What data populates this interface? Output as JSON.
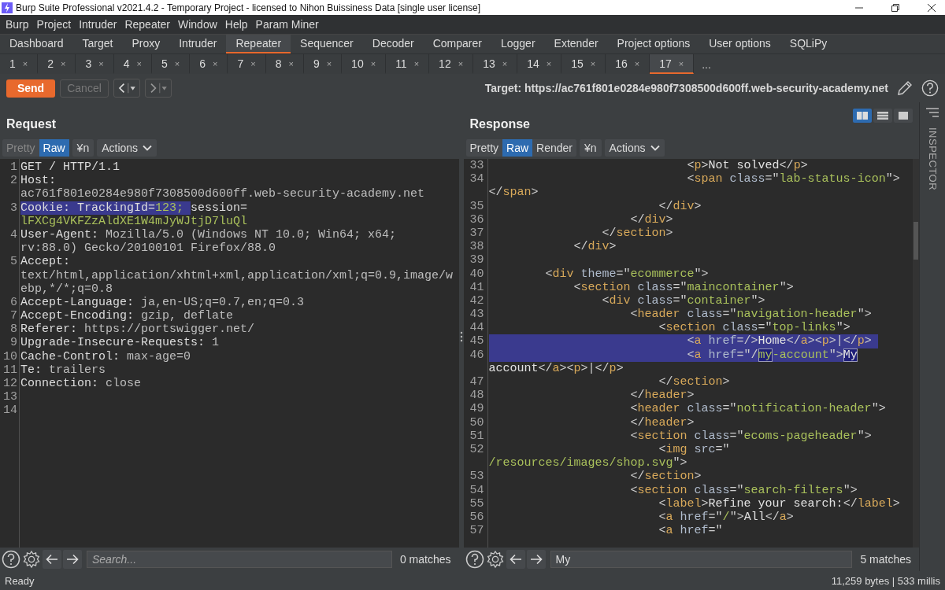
{
  "window": {
    "title": "Burp Suite Professional v2021.4.2 - Temporary Project - licensed to Nihon Buissiness Data [single user license]"
  },
  "menu": [
    "Burp",
    "Project",
    "Intruder",
    "Repeater",
    "Window",
    "Help",
    "Param Miner"
  ],
  "main_tabs": [
    {
      "label": "Dashboard",
      "selected": false
    },
    {
      "label": "Target",
      "selected": false
    },
    {
      "label": "Proxy",
      "selected": false
    },
    {
      "label": "Intruder",
      "selected": false
    },
    {
      "label": "Repeater",
      "selected": true
    },
    {
      "label": "Sequencer",
      "selected": false
    },
    {
      "label": "Decoder",
      "selected": false
    },
    {
      "label": "Comparer",
      "selected": false
    },
    {
      "label": "Logger",
      "selected": false
    },
    {
      "label": "Extender",
      "selected": false
    },
    {
      "label": "Project options",
      "selected": false
    },
    {
      "label": "User options",
      "selected": false
    },
    {
      "label": "SQLiPy",
      "selected": false
    }
  ],
  "repeater_tabs": [
    {
      "label": "1",
      "close": "×",
      "selected": false
    },
    {
      "label": "2",
      "close": "×",
      "selected": false
    },
    {
      "label": "3",
      "close": "×",
      "selected": false
    },
    {
      "label": "4",
      "close": "×",
      "selected": false
    },
    {
      "label": "5",
      "close": "×",
      "selected": false
    },
    {
      "label": "6",
      "close": "×",
      "selected": false
    },
    {
      "label": "7",
      "close": "×",
      "selected": false
    },
    {
      "label": "8",
      "close": "×",
      "selected": false
    },
    {
      "label": "9",
      "close": "×",
      "selected": false
    },
    {
      "label": "10",
      "close": "×",
      "selected": false
    },
    {
      "label": "11",
      "close": "×",
      "selected": false
    },
    {
      "label": "12",
      "close": "×",
      "selected": false
    },
    {
      "label": "13",
      "close": "×",
      "selected": false
    },
    {
      "label": "14",
      "close": "×",
      "selected": false
    },
    {
      "label": "15",
      "close": "×",
      "selected": false
    },
    {
      "label": "16",
      "close": "×",
      "selected": false
    },
    {
      "label": "17",
      "close": "×",
      "selected": true
    }
  ],
  "more_tabs": "...",
  "toolbar": {
    "send": "Send",
    "cancel": {
      "label": "Cancel",
      "disabled": true
    },
    "target": "Target: https://ac761f801e0284e980f7308500d600ff.web-security-academy.net"
  },
  "layout_buttons": [
    {
      "kind": "columns",
      "selected": true
    },
    {
      "kind": "rows",
      "selected": false
    },
    {
      "kind": "single",
      "selected": false
    }
  ],
  "inspector": "INSPECTOR",
  "request": {
    "title": "Request",
    "view_buttons": [
      {
        "label": "Pretty",
        "selected": false,
        "disabled": true
      },
      {
        "label": "Raw",
        "selected": true,
        "disabled": false
      }
    ],
    "newline_button": "¥n",
    "actions": "Actions",
    "lines": [
      {
        "number": "1",
        "highlighted": false,
        "segments": [
          {
            "kind": "name",
            "text": "GET / HTTP/1.1"
          }
        ]
      },
      {
        "number": "2",
        "highlighted": false,
        "segments": [
          {
            "kind": "name",
            "text": "Host:"
          }
        ]
      },
      {
        "highlighted": false,
        "segments": [
          {
            "kind": "value",
            "text": "ac761f801e0284e980f7308500d600ff.web-security-academy.net"
          }
        ]
      },
      {
        "number": "3",
        "highlighted": false,
        "segments": [
          {
            "kind": "name",
            "text": "Cookie: TrackingId=",
            "selected": true
          },
          {
            "kind": "cookie",
            "text": "123; ",
            "selected": true
          },
          {
            "kind": "name",
            "text": "session=",
            "selected": false
          }
        ]
      },
      {
        "highlighted": false,
        "segments": [
          {
            "kind": "cookie",
            "text": "lFXCg4VKFZzAldXE1W4mJyWJtjD7luQl"
          }
        ]
      },
      {
        "number": "4",
        "highlighted": false,
        "segments": [
          {
            "kind": "name",
            "text": "User-Agent:"
          },
          {
            "kind": "value",
            "text": " Mozilla/5.0 (Windows NT 10.0; Win64; x64;"
          }
        ]
      },
      {
        "highlighted": false,
        "segments": [
          {
            "kind": "value",
            "text": "rv:88.0) Gecko/20100101 Firefox/88.0"
          }
        ]
      },
      {
        "number": "5",
        "highlighted": false,
        "segments": [
          {
            "kind": "name",
            "text": "Accept:"
          }
        ]
      },
      {
        "highlighted": false,
        "segments": [
          {
            "kind": "value",
            "text": "text/html,application/xhtml+xml,application/xml;q=0.9,image/w"
          }
        ]
      },
      {
        "highlighted": false,
        "segments": [
          {
            "kind": "value",
            "text": "ebp,*/*;q=0.8"
          }
        ]
      },
      {
        "number": "6",
        "highlighted": false,
        "segments": [
          {
            "kind": "name",
            "text": "Accept-Language:"
          },
          {
            "kind": "value",
            "text": " ja,en-US;q=0.7,en;q=0.3"
          }
        ]
      },
      {
        "number": "7",
        "highlighted": false,
        "segments": [
          {
            "kind": "name",
            "text": "Accept-Encoding:"
          },
          {
            "kind": "value",
            "text": " gzip, deflate"
          }
        ]
      },
      {
        "number": "8",
        "highlighted": false,
        "segments": [
          {
            "kind": "name",
            "text": "Referer:"
          },
          {
            "kind": "value",
            "text": " https://portswigger.net/"
          }
        ]
      },
      {
        "number": "9",
        "highlighted": false,
        "segments": [
          {
            "kind": "name",
            "text": "Upgrade-Insecure-Requests:"
          },
          {
            "kind": "value",
            "text": " 1"
          }
        ]
      },
      {
        "number": "10",
        "highlighted": false,
        "segments": [
          {
            "kind": "name",
            "text": "Cache-Control:"
          },
          {
            "kind": "value",
            "text": " max-age=0"
          }
        ]
      },
      {
        "number": "11",
        "highlighted": false,
        "segments": [
          {
            "kind": "name",
            "text": "Te:"
          },
          {
            "kind": "value",
            "text": " trailers"
          }
        ]
      },
      {
        "number": "12",
        "highlighted": false,
        "segments": [
          {
            "kind": "name",
            "text": "Connection:"
          },
          {
            "kind": "value",
            "text": " close"
          }
        ]
      },
      {
        "number": "13",
        "highlighted": false
      },
      {
        "number": "14",
        "highlighted": false
      }
    ],
    "search": {
      "placeholder": "Search...",
      "matches": "0 matches"
    }
  },
  "response": {
    "title": "Response",
    "view_buttons": [
      {
        "label": "Pretty",
        "selected": false,
        "disabled": false
      },
      {
        "label": "Raw",
        "selected": true,
        "disabled": false
      },
      {
        "label": "Render",
        "selected": false,
        "disabled": false
      }
    ],
    "newline_button": "¥n",
    "actions": "Actions",
    "lines": [
      {
        "number": "33",
        "highlighted": false,
        "segments": [
          {
            "kind": "punct",
            "text": "                            <"
          },
          {
            "kind": "tag",
            "text": "p"
          },
          {
            "kind": "punct",
            "text": ">"
          },
          {
            "kind": "text",
            "text": "Not solved"
          },
          {
            "kind": "punct",
            "text": "</"
          },
          {
            "kind": "tag",
            "text": "p"
          },
          {
            "kind": "punct",
            "text": ">"
          }
        ]
      },
      {
        "number": "34",
        "highlighted": false,
        "segments": [
          {
            "kind": "punct",
            "text": "                            <"
          },
          {
            "kind": "tag",
            "text": "span"
          },
          {
            "kind": "attr",
            "text": " class"
          },
          {
            "kind": "punct",
            "text": "=\""
          },
          {
            "kind": "str",
            "text": "lab-status-icon"
          },
          {
            "kind": "punct",
            "text": "\">"
          }
        ]
      },
      {
        "highlighted": false,
        "segments": [
          {
            "kind": "punct",
            "text": "</"
          },
          {
            "kind": "tag",
            "text": "span"
          },
          {
            "kind": "punct",
            "text": ">"
          }
        ]
      },
      {
        "number": "35",
        "highlighted": false,
        "segments": [
          {
            "kind": "punct",
            "text": "                        </"
          },
          {
            "kind": "tag",
            "text": "div"
          },
          {
            "kind": "punct",
            "text": ">"
          }
        ]
      },
      {
        "number": "36",
        "highlighted": false,
        "segments": [
          {
            "kind": "punct",
            "text": "                    </"
          },
          {
            "kind": "tag",
            "text": "div"
          },
          {
            "kind": "punct",
            "text": ">"
          }
        ]
      },
      {
        "number": "37",
        "highlighted": false,
        "segments": [
          {
            "kind": "punct",
            "text": "                </"
          },
          {
            "kind": "tag",
            "text": "section"
          },
          {
            "kind": "punct",
            "text": ">"
          }
        ]
      },
      {
        "number": "38",
        "highlighted": false,
        "segments": [
          {
            "kind": "punct",
            "text": "            </"
          },
          {
            "kind": "tag",
            "text": "div"
          },
          {
            "kind": "punct",
            "text": ">"
          }
        ]
      },
      {
        "number": "39",
        "highlighted": false
      },
      {
        "number": "40",
        "highlighted": false,
        "segments": [
          {
            "kind": "punct",
            "text": "        <"
          },
          {
            "kind": "tag",
            "text": "div"
          },
          {
            "kind": "attr",
            "text": " theme"
          },
          {
            "kind": "punct",
            "text": "=\""
          },
          {
            "kind": "str",
            "text": "ecommerce"
          },
          {
            "kind": "punct",
            "text": "\">"
          }
        ]
      },
      {
        "number": "41",
        "highlighted": false,
        "segments": [
          {
            "kind": "punct",
            "text": "            <"
          },
          {
            "kind": "tag",
            "text": "section"
          },
          {
            "kind": "attr",
            "text": " class"
          },
          {
            "kind": "punct",
            "text": "=\""
          },
          {
            "kind": "str",
            "text": "maincontainer"
          },
          {
            "kind": "punct",
            "text": "\">"
          }
        ]
      },
      {
        "number": "42",
        "highlighted": false,
        "segments": [
          {
            "kind": "punct",
            "text": "                <"
          },
          {
            "kind": "tag",
            "text": "div"
          },
          {
            "kind": "attr",
            "text": " class"
          },
          {
            "kind": "punct",
            "text": "=\""
          },
          {
            "kind": "str",
            "text": "container"
          },
          {
            "kind": "punct",
            "text": "\">"
          }
        ]
      },
      {
        "number": "43",
        "highlighted": false,
        "segments": [
          {
            "kind": "punct",
            "text": "                    <"
          },
          {
            "kind": "tag",
            "text": "header"
          },
          {
            "kind": "attr",
            "text": " class"
          },
          {
            "kind": "punct",
            "text": "=\""
          },
          {
            "kind": "str",
            "text": "navigation-header"
          },
          {
            "kind": "punct",
            "text": "\">"
          }
        ]
      },
      {
        "number": "44",
        "highlighted": false,
        "segments": [
          {
            "kind": "punct",
            "text": "                        <"
          },
          {
            "kind": "tag",
            "text": "section"
          },
          {
            "kind": "attr",
            "text": " class"
          },
          {
            "kind": "punct",
            "text": "=\""
          },
          {
            "kind": "str",
            "text": "top-links"
          },
          {
            "kind": "punct",
            "text": "\">"
          }
        ]
      },
      {
        "number": "45",
        "highlighted": true,
        "segments": [
          {
            "kind": "punct",
            "text": "                            <"
          },
          {
            "kind": "tag",
            "text": "a"
          },
          {
            "kind": "attr",
            "text": " href"
          },
          {
            "kind": "punct",
            "text": "=/>"
          },
          {
            "kind": "text",
            "text": "Home"
          },
          {
            "kind": "punct",
            "text": "</"
          },
          {
            "kind": "tag",
            "text": "a"
          },
          {
            "kind": "punct",
            "text": "><"
          },
          {
            "kind": "tag",
            "text": "p"
          },
          {
            "kind": "punct",
            "text": ">|</"
          },
          {
            "kind": "tag",
            "text": "p"
          },
          {
            "kind": "punct",
            "text": ">"
          }
        ]
      },
      {
        "number": "46",
        "highlighted": true,
        "segments": [
          {
            "kind": "punct",
            "text": "                            <",
            "match": false
          },
          {
            "kind": "tag",
            "text": "a",
            "match": false
          },
          {
            "kind": "attr",
            "text": " href",
            "match": false
          },
          {
            "kind": "punct",
            "text": "=\"/",
            "match": false
          },
          {
            "kind": "str",
            "text": "my",
            "match": true
          },
          {
            "kind": "str",
            "text": "-account",
            "match": false
          },
          {
            "kind": "punct",
            "text": "\">",
            "match": false
          },
          {
            "kind": "text",
            "text": "My",
            "match": true
          }
        ]
      },
      {
        "highlighted": false,
        "segments": [
          {
            "kind": "text",
            "text": "account"
          },
          {
            "kind": "punct",
            "text": "</"
          },
          {
            "kind": "tag",
            "text": "a"
          },
          {
            "kind": "punct",
            "text": "><"
          },
          {
            "kind": "tag",
            "text": "p"
          },
          {
            "kind": "punct",
            "text": ">|</"
          },
          {
            "kind": "tag",
            "text": "p"
          },
          {
            "kind": "punct",
            "text": ">"
          }
        ]
      },
      {
        "number": "47",
        "highlighted": false,
        "segments": [
          {
            "kind": "punct",
            "text": "                        </"
          },
          {
            "kind": "tag",
            "text": "section"
          },
          {
            "kind": "punct",
            "text": ">"
          }
        ]
      },
      {
        "number": "48",
        "highlighted": false,
        "segments": [
          {
            "kind": "punct",
            "text": "                    </"
          },
          {
            "kind": "tag",
            "text": "header"
          },
          {
            "kind": "punct",
            "text": ">"
          }
        ]
      },
      {
        "number": "49",
        "highlighted": false,
        "segments": [
          {
            "kind": "punct",
            "text": "                    <"
          },
          {
            "kind": "tag",
            "text": "header"
          },
          {
            "kind": "attr",
            "text": " class"
          },
          {
            "kind": "punct",
            "text": "=\""
          },
          {
            "kind": "str",
            "text": "notification-header"
          },
          {
            "kind": "punct",
            "text": "\">"
          }
        ]
      },
      {
        "number": "50",
        "highlighted": false,
        "segments": [
          {
            "kind": "punct",
            "text": "                    </"
          },
          {
            "kind": "tag",
            "text": "header"
          },
          {
            "kind": "punct",
            "text": ">"
          }
        ]
      },
      {
        "number": "51",
        "highlighted": false,
        "segments": [
          {
            "kind": "punct",
            "text": "                    <"
          },
          {
            "kind": "tag",
            "text": "section"
          },
          {
            "kind": "attr",
            "text": " class"
          },
          {
            "kind": "punct",
            "text": "=\""
          },
          {
            "kind": "str",
            "text": "ecoms-pageheader"
          },
          {
            "kind": "punct",
            "text": "\">"
          }
        ]
      },
      {
        "number": "52",
        "highlighted": false,
        "segments": [
          {
            "kind": "punct",
            "text": "                        <"
          },
          {
            "kind": "tag",
            "text": "img"
          },
          {
            "kind": "attr",
            "text": " src"
          },
          {
            "kind": "punct",
            "text": "=\""
          }
        ]
      },
      {
        "highlighted": false,
        "segments": [
          {
            "kind": "str",
            "text": "/resources/images/shop.svg"
          },
          {
            "kind": "punct",
            "text": "\">"
          }
        ]
      },
      {
        "number": "53",
        "highlighted": false,
        "segments": [
          {
            "kind": "punct",
            "text": "                    </"
          },
          {
            "kind": "tag",
            "text": "section"
          },
          {
            "kind": "punct",
            "text": ">"
          }
        ]
      },
      {
        "number": "54",
        "highlighted": false,
        "segments": [
          {
            "kind": "punct",
            "text": "                    <"
          },
          {
            "kind": "tag",
            "text": "section"
          },
          {
            "kind": "attr",
            "text": " class"
          },
          {
            "kind": "punct",
            "text": "=\""
          },
          {
            "kind": "str",
            "text": "search-filters"
          },
          {
            "kind": "punct",
            "text": "\">"
          }
        ]
      },
      {
        "number": "55",
        "highlighted": false,
        "segments": [
          {
            "kind": "punct",
            "text": "                        <"
          },
          {
            "kind": "tag",
            "text": "label"
          },
          {
            "kind": "punct",
            "text": ">"
          },
          {
            "kind": "text",
            "text": "Refine your search:"
          },
          {
            "kind": "punct",
            "text": "</"
          },
          {
            "kind": "tag",
            "text": "label"
          },
          {
            "kind": "punct",
            "text": ">"
          }
        ]
      },
      {
        "number": "56",
        "highlighted": false,
        "segments": [
          {
            "kind": "punct",
            "text": "                        <"
          },
          {
            "kind": "tag",
            "text": "a"
          },
          {
            "kind": "attr",
            "text": " href"
          },
          {
            "kind": "punct",
            "text": "=\""
          },
          {
            "kind": "str",
            "text": "/"
          },
          {
            "kind": "punct",
            "text": "\">"
          },
          {
            "kind": "text",
            "text": "All"
          },
          {
            "kind": "punct",
            "text": "</"
          },
          {
            "kind": "tag",
            "text": "a"
          },
          {
            "kind": "punct",
            "text": ">"
          }
        ]
      },
      {
        "number": "57",
        "highlighted": false,
        "segments": [
          {
            "kind": "punct",
            "text": "                        <"
          },
          {
            "kind": "tag",
            "text": "a"
          },
          {
            "kind": "attr",
            "text": " href"
          },
          {
            "kind": "punct",
            "text": "=\""
          }
        ]
      }
    ],
    "search": {
      "value": "My",
      "matches": "5 matches"
    }
  },
  "status_bar": {
    "left": "Ready",
    "right": "11,259 bytes | 533 millis"
  }
}
